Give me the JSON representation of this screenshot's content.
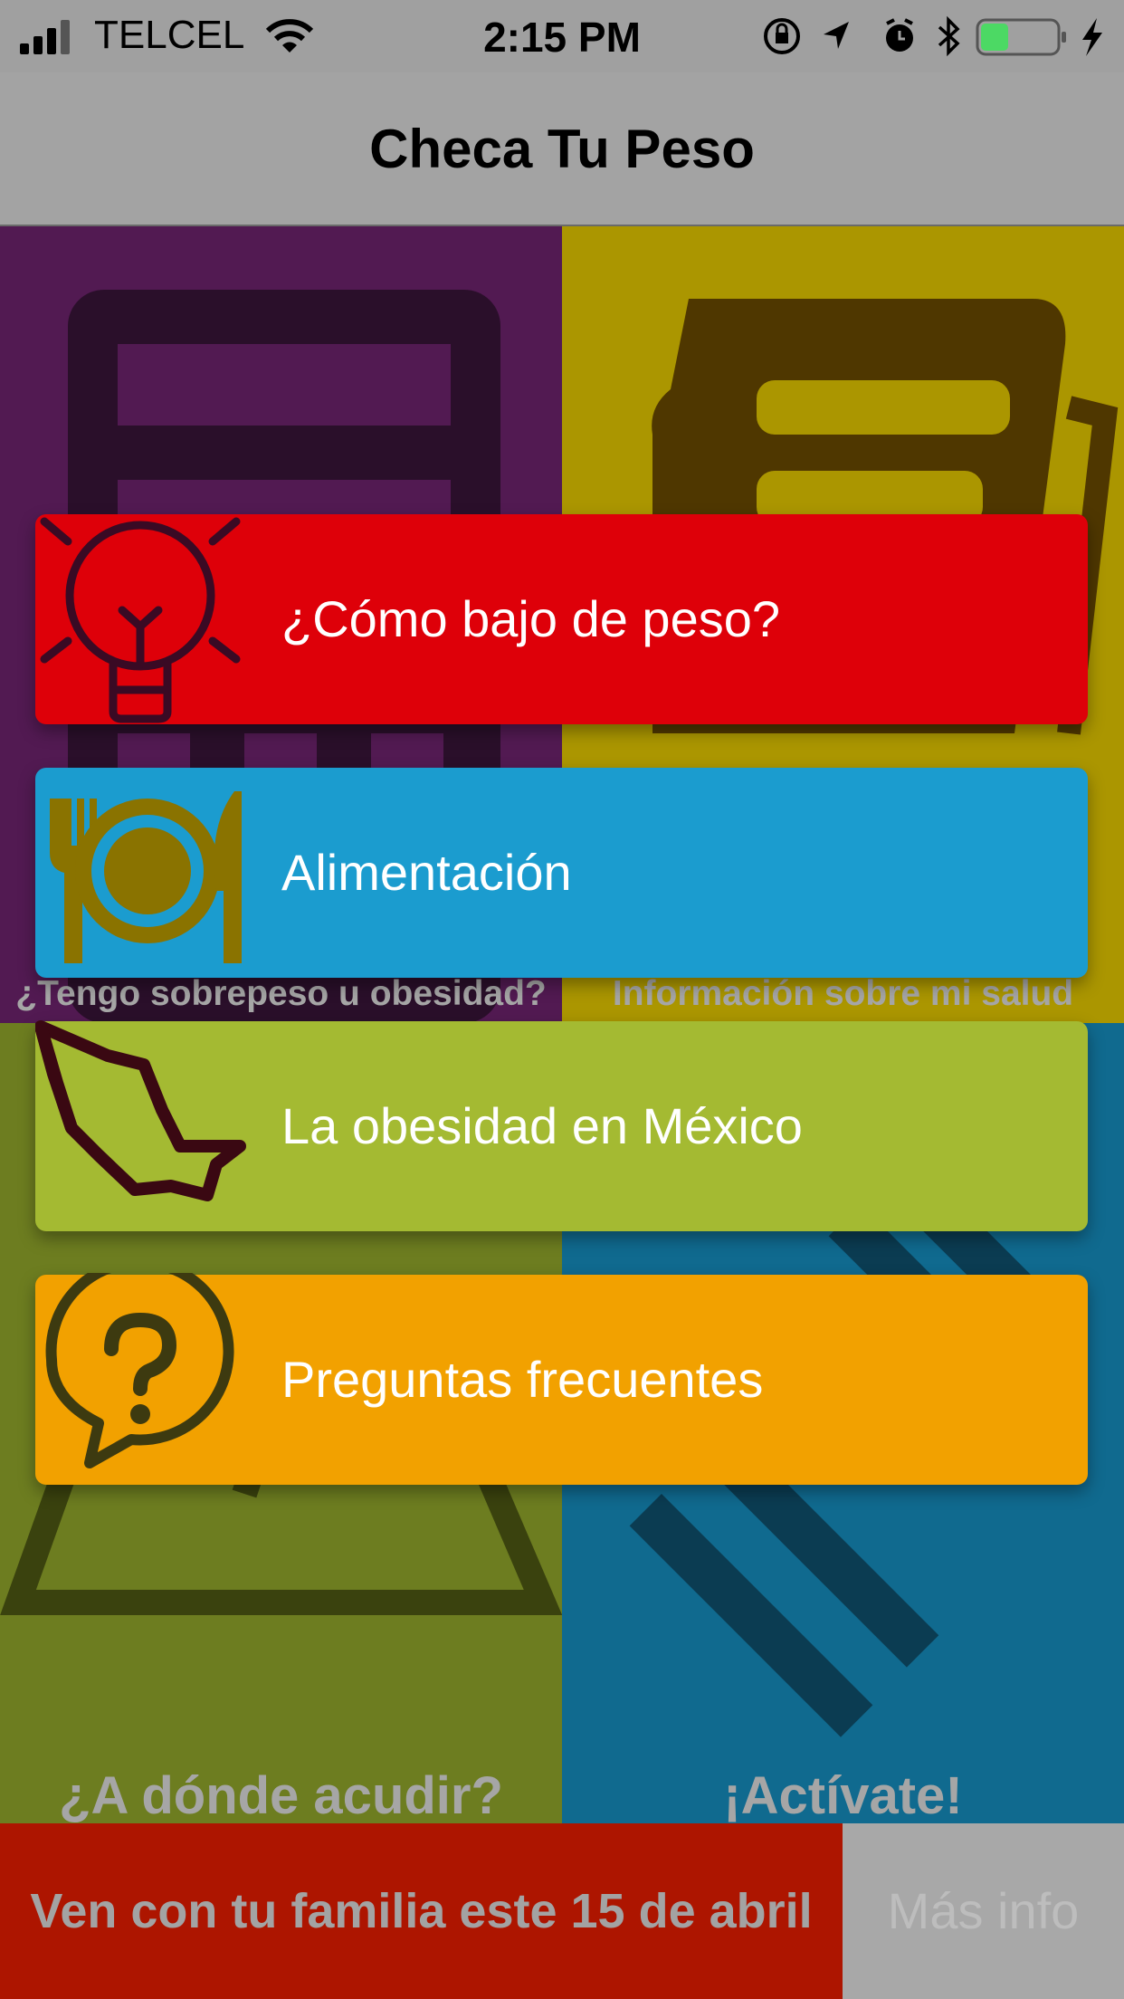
{
  "status_bar": {
    "carrier": "TELCEL",
    "time": "2:15 PM",
    "icons": [
      "signal-icon",
      "wifi-icon",
      "orientation-lock-icon",
      "location-icon",
      "alarm-icon",
      "bluetooth-icon",
      "battery-icon",
      "charging-icon"
    ],
    "battery_color": "#4cd964"
  },
  "nav": {
    "title": "Checa Tu Peso"
  },
  "tiles": [
    {
      "caption": "¿Tengo sobrepeso u obesidad?",
      "color": "#521a52",
      "icon": "calculator-icon"
    },
    {
      "caption": "Información sobre mi salud",
      "color": "#ab9600",
      "icon": "book-icon"
    },
    {
      "caption": "¿A dónde acudir?",
      "color": "#6d7d20",
      "icon": "location-pin-icon"
    },
    {
      "caption": "¡Actívate!",
      "color": "#106a8f",
      "icon": "running-icon"
    }
  ],
  "menu": [
    {
      "label": "¿Cómo bajo de peso?",
      "color": "#de0009",
      "icon": "lightbulb-icon"
    },
    {
      "label": "Alimentación",
      "color": "#1b9ccf",
      "icon": "plate-cutlery-icon"
    },
    {
      "label": "La obesidad en México",
      "color": "#a4ba32",
      "icon": "mexico-map-icon"
    },
    {
      "label": "Preguntas frecuentes",
      "color": "#f2a100",
      "icon": "question-bubble-icon"
    }
  ],
  "banner": {
    "text": "Ven con tu familia este 15 de abril",
    "color": "#ad1500"
  },
  "more_button": {
    "label": "Más info"
  }
}
